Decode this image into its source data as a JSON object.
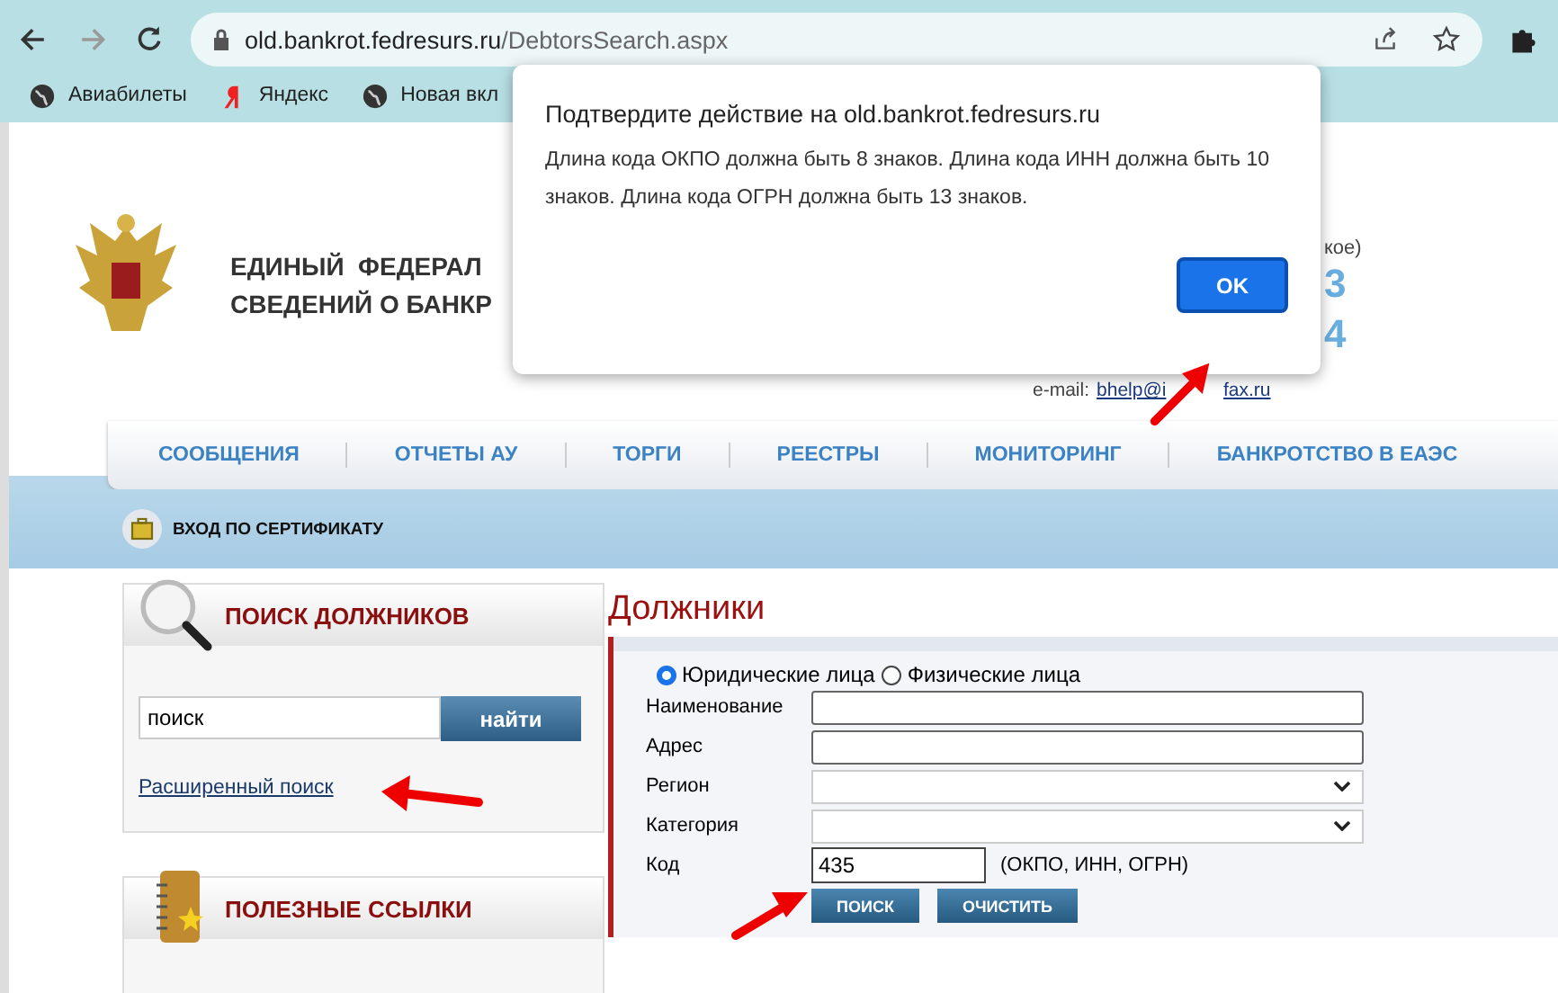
{
  "browser": {
    "url_host": "old.bankrot.fedresurs.ru",
    "url_path": "/DebtorsSearch.aspx",
    "bookmarks": [
      {
        "label": "Авиабилеты",
        "kind": "globe"
      },
      {
        "label": "Яндекс",
        "kind": "yandex"
      },
      {
        "label": "Новая вкл",
        "kind": "globe"
      }
    ]
  },
  "dialog": {
    "title": "Подтвердите действие на old.bankrot.fedresurs.ru",
    "message": "Длина кода ОКПО должна быть 8 знаков. Длина кода ИНН должна быть 10 знаков. Длина кода ОГРН должна быть 13 знаков.",
    "ok_button": "OK"
  },
  "site": {
    "title_lines": [
      "ЕДИНЫЙ  ФЕДЕРАЛ",
      "СВЕДЕНИЙ О БАНКР"
    ],
    "contact": {
      "note": "кое)",
      "digits": [
        "3",
        "4"
      ],
      "email_label": "e-mail:",
      "email_parts": [
        "bhelp@i",
        "fax.ru"
      ]
    },
    "nav": [
      "СООБЩЕНИЯ",
      "ОТЧЕТЫ АУ",
      "ТОРГИ",
      "РЕЕСТРЫ",
      "МОНИТОРИНГ",
      "БАНКРОТСТВО В ЕАЭС"
    ],
    "cert_login": "ВХОД ПО СЕРТИФИКАТУ",
    "search_panel": {
      "title": "ПОИСК ДОЛЖНИКОВ",
      "value": "поиск",
      "button": "найти",
      "advanced_link": "Расширенный поиск"
    },
    "links_panel": {
      "title": "ПОЛЕЗНЫЕ ССЫЛКИ"
    },
    "debtors": {
      "title": "Должники",
      "person_types": [
        {
          "label": "Юридические лица",
          "selected": true
        },
        {
          "label": "Физические лица",
          "selected": false
        }
      ],
      "fields": [
        {
          "label": "Наименование",
          "kind": "text"
        },
        {
          "label": "Адрес",
          "kind": "text"
        },
        {
          "label": "Регион",
          "kind": "select"
        },
        {
          "label": "Категория",
          "kind": "select"
        },
        {
          "label": "Код",
          "kind": "code",
          "value": "435",
          "hint": "(ОКПО, ИНН, ОГРН)"
        }
      ],
      "buttons": [
        "ПОИСК",
        "ОЧИСТИТЬ"
      ]
    }
  }
}
